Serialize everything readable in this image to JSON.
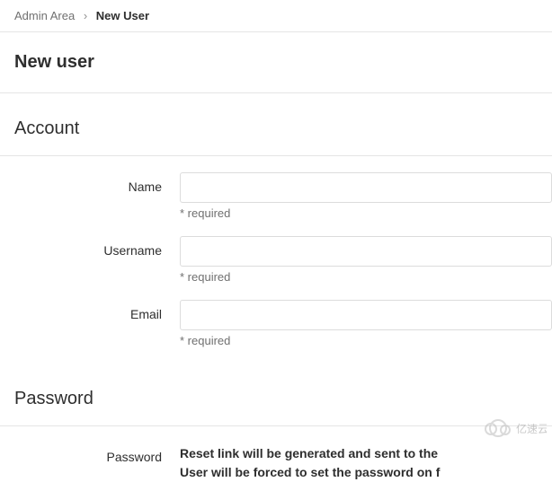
{
  "breadcrumb": {
    "root": "Admin Area",
    "current": "New User"
  },
  "page": {
    "title": "New user"
  },
  "sections": {
    "account": {
      "title": "Account"
    },
    "password": {
      "title": "Password"
    }
  },
  "fields": {
    "name": {
      "label": "Name",
      "value": "",
      "hint": "* required"
    },
    "username": {
      "label": "Username",
      "value": "",
      "hint": "* required"
    },
    "email": {
      "label": "Email",
      "value": "",
      "hint": "* required"
    },
    "password": {
      "label": "Password",
      "info_line1": "Reset link will be generated and sent to the",
      "info_line2": "User will be forced to set the password on f"
    }
  },
  "watermark": {
    "text": "亿速云"
  }
}
